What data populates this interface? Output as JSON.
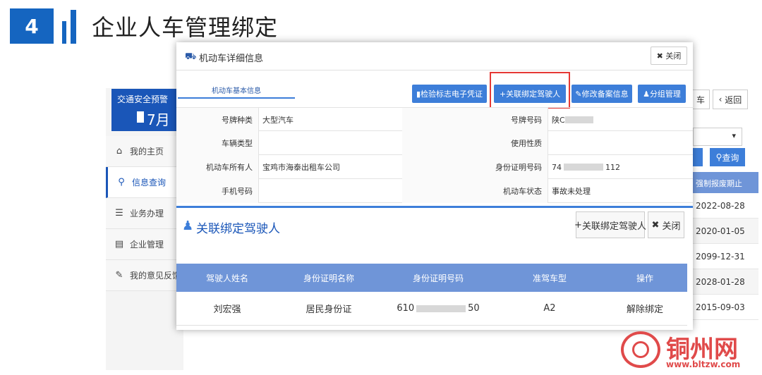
{
  "slide": {
    "number": "4",
    "title": "企业人车管理绑定"
  },
  "background_app": {
    "alert_title": "交通安全预警",
    "alert_month": "7月",
    "menu": [
      {
        "label": "我的主页",
        "icon": "home-icon"
      },
      {
        "label": "信息查询",
        "icon": "search-icon",
        "active": true
      },
      {
        "label": "业务办理",
        "icon": "stack-icon"
      },
      {
        "label": "企业管理",
        "icon": "document-icon"
      },
      {
        "label": "我的意见反馈",
        "icon": "feedback-icon"
      }
    ],
    "right_buttons": {
      "car_fragment": "车",
      "back": "返回",
      "search": "查询"
    },
    "right_header": "强制报废期止",
    "right_dates": [
      "2022-08-28",
      "2020-01-05",
      "2099-12-31",
      "2028-01-28",
      "2015-09-03"
    ]
  },
  "modal": {
    "title": "机动车详细信息",
    "close_label": "关闭",
    "tab_basic": "机动车基本信息",
    "actions": {
      "inspection_label": "检验标志电子凭证",
      "bind_driver_label": "关联绑定驾驶人",
      "modify_record_label": "修改备案信息",
      "group_manage_label": "分组管理"
    },
    "info": {
      "plate_type_label": "号牌种类",
      "plate_type_value": "大型汽车",
      "plate_number_label": "号牌号码",
      "plate_number_value": "陕C",
      "vehicle_type_label": "车辆类型",
      "usage_label": "使用性质",
      "owner_label": "机动车所有人",
      "owner_value": "宝鸡市海泰出租车公司",
      "id_number_label": "身份证明号码",
      "id_number_prefix": "74",
      "id_number_suffix": "112",
      "phone_label": "手机号码",
      "status_label": "机动车状态",
      "status_value": "事故未处理"
    },
    "driver_section": {
      "title": "关联绑定驾驶人",
      "bind_button": "关联绑定驾驶人",
      "close_button": "关闭",
      "columns": [
        "驾驶人姓名",
        "身份证明名称",
        "身份证明号码",
        "准驾车型",
        "操作"
      ],
      "rows": [
        {
          "name": "刘宏强",
          "id_type": "居民身份证",
          "id_prefix": "610",
          "id_suffix": "50",
          "class": "A2",
          "action": "解除绑定"
        }
      ]
    }
  },
  "watermark": {
    "text": "铜州网",
    "url": "www.bltzw.com"
  },
  "colors": {
    "primary": "#1565c0",
    "button_blue": "#3d7ed9",
    "table_head": "#6f95d8",
    "highlight_red": "#e53935",
    "watermark_red": "#e04a4a"
  }
}
